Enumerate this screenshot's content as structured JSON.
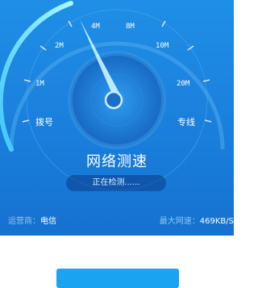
{
  "gauge": {
    "labels": {
      "dial": "拨号",
      "m1": "1M",
      "m2": "2M",
      "m4": "4M",
      "m8": "8M",
      "m10": "10M",
      "m20": "20M",
      "line": "专线"
    },
    "level_fraction": 0.28
  },
  "title": "网络测速",
  "status": "正在检测......",
  "footer": {
    "carrier_label": "运营商：",
    "carrier_value": "电信",
    "speed_label": "最大网速：",
    "speed_value": "469KB/S"
  },
  "colors": {
    "panel": "#1a7fdc",
    "arc_glow": "#7ff0ff",
    "needle": "#c9f4ff",
    "button": "#19a3f0"
  }
}
